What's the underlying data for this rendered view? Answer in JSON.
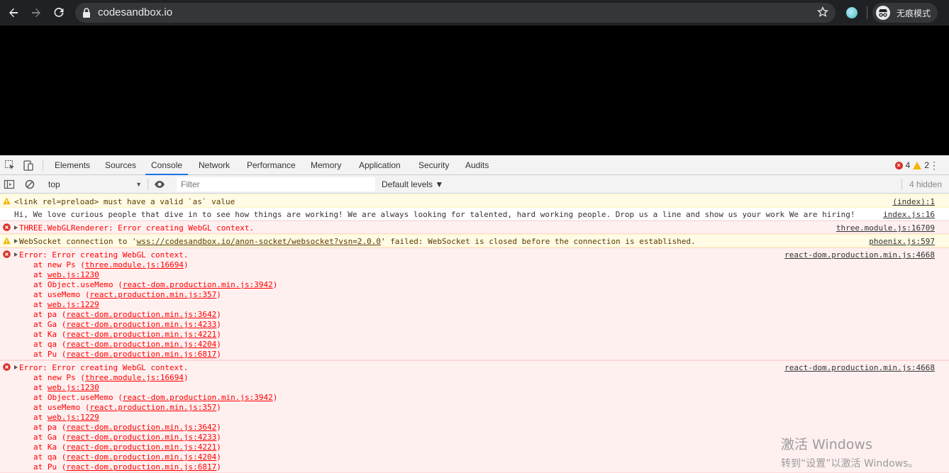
{
  "browser": {
    "url": "codesandbox.io",
    "incognito_label": "无痕模式"
  },
  "devtools": {
    "tabs": [
      "Elements",
      "Sources",
      "Console",
      "Network",
      "Performance",
      "Memory",
      "Application",
      "Security",
      "Audits"
    ],
    "active_tab": "Console",
    "error_count": "4",
    "warning_count": "2",
    "context": "top",
    "filter_placeholder": "Filter",
    "levels_label": "Default levels ▼",
    "hidden_label": "4 hidden"
  },
  "messages": [
    {
      "level": "warn",
      "expandable": false,
      "text": "<link rel=preload> must have a valid `as` value",
      "source": "(index):1"
    },
    {
      "level": "info",
      "expandable": false,
      "text": "Hi, We love curious people that dive in to see how things are working! We are always looking for talented, hard working people. Drop us a line and show us your work We are hiring!",
      "source": "index.js:16"
    },
    {
      "level": "error",
      "expandable": true,
      "text": "THREE.WebGLRenderer: Error creating WebGL context.",
      "source": "three.module.js:16709"
    },
    {
      "level": "warn",
      "expandable": true,
      "text_prefix": "WebSocket connection to '",
      "text_link": "wss://codesandbox.io/anon-socket/websocket?vsn=2.0.0",
      "text_suffix": "' failed: WebSocket is closed before the connection is established.",
      "source": "phoenix.js:597"
    },
    {
      "level": "error",
      "expandable": true,
      "text": "Error: Error creating WebGL context.",
      "source": "react-dom.production.min.js:4668",
      "stack": [
        {
          "fn": "at new Ps (",
          "loc": "three.module.js:16694",
          "end": ")"
        },
        {
          "fn": "at ",
          "loc": "web.js:1230",
          "end": ""
        },
        {
          "fn": "at Object.useMemo (",
          "loc": "react-dom.production.min.js:3942",
          "end": ")"
        },
        {
          "fn": "at useMemo (",
          "loc": "react.production.min.js:357",
          "end": ")"
        },
        {
          "fn": "at ",
          "loc": "web.js:1229",
          "end": ""
        },
        {
          "fn": "at pa (",
          "loc": "react-dom.production.min.js:3642",
          "end": ")"
        },
        {
          "fn": "at Ga (",
          "loc": "react-dom.production.min.js:4233",
          "end": ")"
        },
        {
          "fn": "at Ka (",
          "loc": "react-dom.production.min.js:4221",
          "end": ")"
        },
        {
          "fn": "at qa (",
          "loc": "react-dom.production.min.js:4204",
          "end": ")"
        },
        {
          "fn": "at Pu (",
          "loc": "react-dom.production.min.js:6817",
          "end": ")"
        }
      ]
    },
    {
      "level": "error",
      "expandable": true,
      "text": "Error: Error creating WebGL context.",
      "source": "react-dom.production.min.js:4668",
      "stack": [
        {
          "fn": "at new Ps (",
          "loc": "three.module.js:16694",
          "end": ")"
        },
        {
          "fn": "at ",
          "loc": "web.js:1230",
          "end": ""
        },
        {
          "fn": "at Object.useMemo (",
          "loc": "react-dom.production.min.js:3942",
          "end": ")"
        },
        {
          "fn": "at useMemo (",
          "loc": "react.production.min.js:357",
          "end": ")"
        },
        {
          "fn": "at ",
          "loc": "web.js:1229",
          "end": ""
        },
        {
          "fn": "at pa (",
          "loc": "react-dom.production.min.js:3642",
          "end": ")"
        },
        {
          "fn": "at Ga (",
          "loc": "react-dom.production.min.js:4233",
          "end": ")"
        },
        {
          "fn": "at Ka (",
          "loc": "react-dom.production.min.js:4221",
          "end": ")"
        },
        {
          "fn": "at qa (",
          "loc": "react-dom.production.min.js:4204",
          "end": ")"
        },
        {
          "fn": "at Pu (",
          "loc": "react-dom.production.min.js:6817",
          "end": ")"
        }
      ]
    }
  ],
  "watermark": {
    "line1": "激活 Windows",
    "line2": "转到“设置”以激活 Windows。"
  }
}
